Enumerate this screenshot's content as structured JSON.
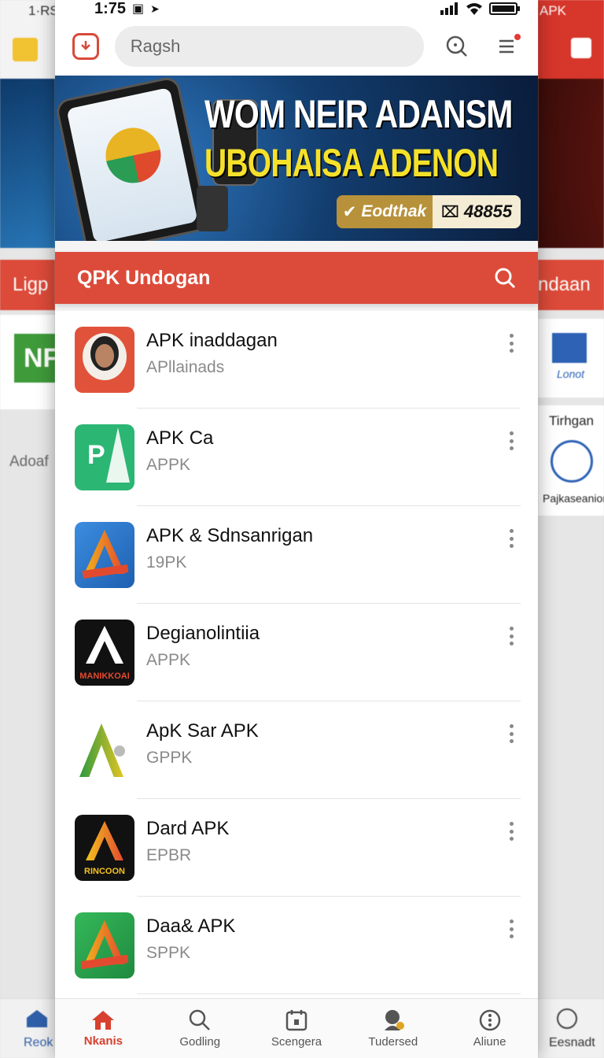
{
  "status_bar": {
    "time": "1:75",
    "left_side_time": "1·RS",
    "right_side_label": "APK"
  },
  "search": {
    "value": "Ragsh"
  },
  "banner": {
    "headline_1": "WOM NEIR ADANSM",
    "headline_2": "UBOHAISA ADENON",
    "pill_left": "Eodthak",
    "pill_right": "48855"
  },
  "section": {
    "title": "QPK Undogan"
  },
  "apps": [
    {
      "title": "APK inaddagan",
      "subtitle": "APllainads",
      "icon": "avatar-icon"
    },
    {
      "title": "APK Ca",
      "subtitle": "APPK",
      "icon": "green-doc-icon"
    },
    {
      "title": "APK & Sdnsanrigan",
      "subtitle": "19PK",
      "icon": "colorful-a-icon"
    },
    {
      "title": "Degianolintiia",
      "subtitle": "APPK",
      "icon": "black-a-icon",
      "icon_caption": "MANIKKOAI"
    },
    {
      "title": "ApK Sar APK",
      "subtitle": "GPPK",
      "icon": "green-a-icon"
    },
    {
      "title": "Dard APK",
      "subtitle": "EPBR",
      "icon": "gold-arrow-icon",
      "icon_caption": "RINCOON"
    },
    {
      "title": "Daa& APK",
      "subtitle": "SPPK",
      "icon": "green-red-a-icon"
    }
  ],
  "bottom_nav": [
    {
      "label": "Nkanis",
      "icon": "home-icon",
      "active": true
    },
    {
      "label": "Godling",
      "icon": "search-icon",
      "active": false
    },
    {
      "label": "Scengera",
      "icon": "calendar-icon",
      "active": false
    },
    {
      "label": "Tudersed",
      "icon": "profile-icon",
      "active": false
    },
    {
      "label": "Aliune",
      "icon": "more-circle-icon",
      "active": false
    }
  ],
  "left_panel": {
    "section_label": "Ligp",
    "tile_text": "NF",
    "side_text": "Adoaf",
    "nav_label": "Reok"
  },
  "right_panel": {
    "section_label": "ndaan",
    "card1_caption": "Lonot",
    "card2_title": "Tirhgan",
    "card2_caption": "Pajkaseanion",
    "nav_label": "Eesnadt"
  },
  "colors": {
    "accent_red": "#dc4b3a",
    "banner_yellow": "#f5e12a",
    "nav_blue": "#2f5fa8"
  }
}
